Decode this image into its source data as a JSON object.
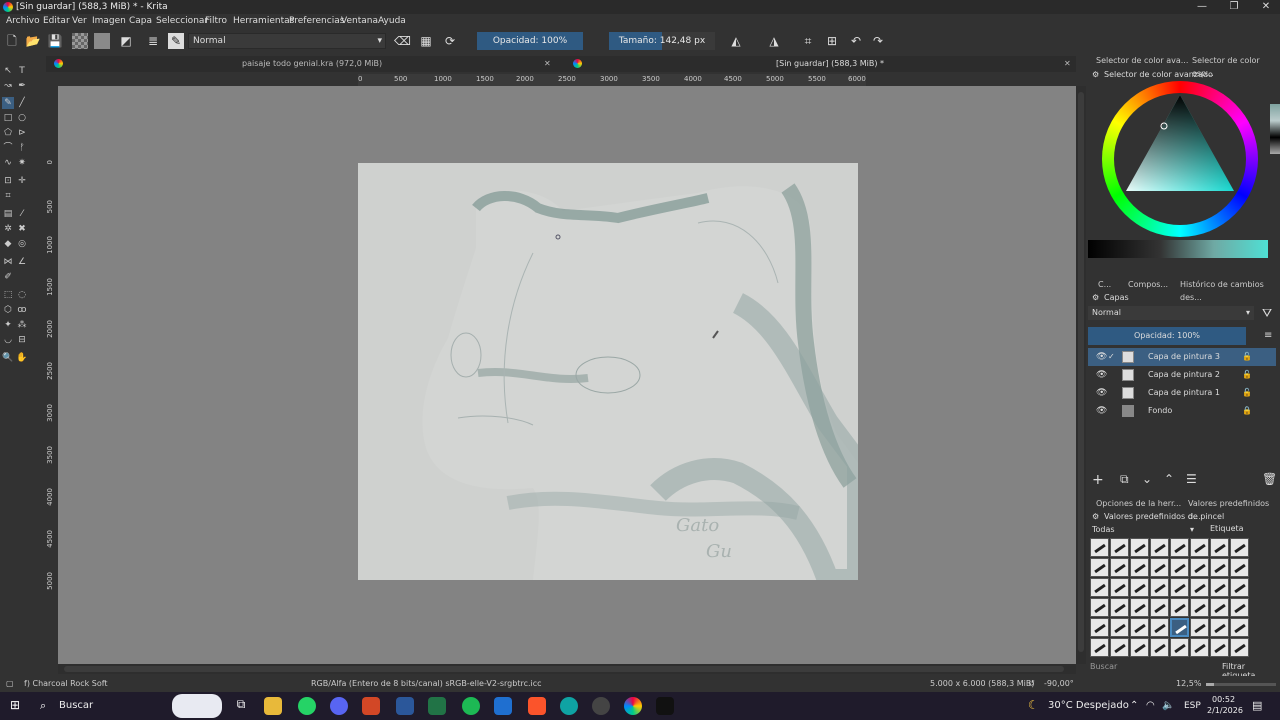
{
  "window": {
    "title": "[Sin guardar]  (588,3 MiB) * - Krita",
    "buttons": {
      "minimize": "—",
      "maximize": "❐",
      "close": "✕"
    }
  },
  "menu": [
    "Archivo",
    "Editar",
    "Ver",
    "Imagen",
    "Capa",
    "Seleccionar",
    "Filtro",
    "Herramientas",
    "Preferencias",
    "Ventana",
    "Ayuda"
  ],
  "toolbar": {
    "blend_mode": "Normal",
    "opacity_label": "Opacidad: 100%",
    "size_label": "Tamaño: 142,48 px"
  },
  "tabs": [
    {
      "label": "paisaje todo genial.kra (972,0 MiB)",
      "close": "✕"
    },
    {
      "label": "[Sin guardar]  (588,3 MiB) *",
      "close": "✕"
    }
  ],
  "ruler_h": [
    "0",
    "500",
    "1000",
    "1500",
    "2000",
    "2500",
    "3000",
    "3500",
    "4000",
    "4500",
    "5000",
    "5500",
    "6000"
  ],
  "ruler_v": [
    "0",
    "500",
    "1000",
    "1500",
    "2000",
    "2500",
    "3000",
    "3500",
    "4000",
    "4500",
    "5000"
  ],
  "canvas": {
    "handwritten": [
      "Gato",
      "Gu"
    ]
  },
  "docker": {
    "tabs": [
      "Selector de color ava...",
      "Selector de color esp..."
    ],
    "color_selector_title": "Selector de color avanzado",
    "layers_tabs": [
      "C...",
      "Compos...",
      "Histórico de cambios des..."
    ],
    "layers_title": "Capas",
    "layers_blend": "Normal",
    "layers_opacity": "Opacidad:  100%",
    "layers": [
      {
        "name": "Capa de pintura 3",
        "active": true
      },
      {
        "name": "Capa de pintura 2",
        "active": false
      },
      {
        "name": "Capa de pintura 1",
        "active": false
      },
      {
        "name": "Fondo",
        "active": false
      }
    ],
    "bottom_tabs": [
      "Opciones de la herr...",
      "Valores predefinidos d..."
    ],
    "presets_title": "Valores predefinidos de pincel",
    "presets_filter": "Todas",
    "presets_tag": "Etiqueta",
    "search_placeholder": "Buscar",
    "filter_tag": "Filtrar etiqueta"
  },
  "status": {
    "brush": "f) Charcoal Rock Soft",
    "colorspace": "RGB/Alfa (Entero de 8 bits/canal)  sRGB-elle-V2-srgbtrc.icc",
    "dims": "5.000 x 6.000 (588,3 MiB)",
    "rotation": "-90,00°",
    "zoom": "12,5%"
  },
  "taskbar": {
    "search": "Buscar",
    "weather": "30°C  Despejado",
    "lang": "ESP",
    "time": "00:52",
    "date": "2/1/2026"
  },
  "colors": {
    "accent": "#2f5a82",
    "panel": "#323232",
    "canvas_bg": "#838383",
    "paper": "#cfd1cf"
  }
}
